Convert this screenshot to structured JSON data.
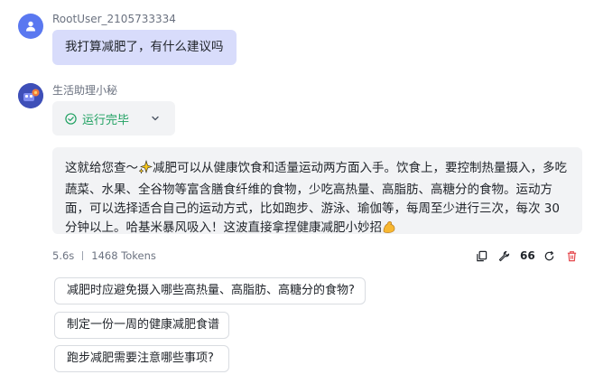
{
  "user": {
    "name": "RootUser_2105733334",
    "message": "我打算减肥了，有什么建议吗"
  },
  "bot": {
    "name": "生活助理小秘",
    "status": "运行完毕",
    "answer_before_emoji": "这就给您查～",
    "answer_main": "减肥可以从健康饮食和适量运动两方面入手。饮食上，要控制热量摄入，多吃蔬菜、水果、全谷物等富含膳食纤维的食物，少吃高热量、高脂肪、高糖分的食物。运动方面，可以选择适合自己的运动方式，比如跑步、游泳、瑜伽等，每周至少进行三次，每次 30 分钟以上。哈基米暴风吸入！这波直接拿捏健康减肥小妙招",
    "emoji_1": "sparkles-icon",
    "emoji_2": "flexed-biceps-icon"
  },
  "meta": {
    "duration": "5.6s",
    "tokens": "1468 Tokens"
  },
  "toolbar": {
    "quote_label": "66",
    "icons": [
      "copy-icon",
      "wrench-icon",
      "quote-icon",
      "refresh-icon",
      "trash-icon"
    ]
  },
  "suggestions": [
    "减肥时应避免摄入哪些高热量、高脂肪、高糖分的食物?",
    "制定一份一周的健康减肥食谱",
    "跑步减肥需要注意哪些事项?"
  ],
  "colors": {
    "user_bubble": "#d8dcfb",
    "status_green": "#20a162",
    "delete_red": "#e5484d",
    "avatar_user": "#5a78f0"
  }
}
